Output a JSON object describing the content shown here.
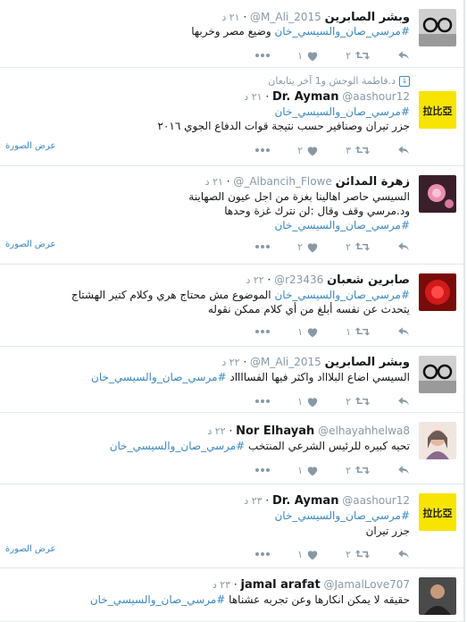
{
  "view_photo_label": "عرض الصورة",
  "tweets": [
    {
      "name": "وبشر الصابرين",
      "handle": "@M_Ali_2015",
      "time": "٢١ د",
      "lines": [
        [
          {
            "t": "#مرسي_صان_والسيسي_خان",
            "h": true
          },
          {
            "t": " وضيع مصر وخربها",
            "h": false
          }
        ]
      ],
      "retweets": "٢",
      "likes": "١",
      "has_photo": false
    },
    {
      "retweeted_by": "د.فاطمة الوحش و1 آخر يتابعان",
      "name": "Dr. Ayman",
      "handle": "@aashour12",
      "time": "٢١ د",
      "lines": [
        [
          {
            "t": "#مرسي_صان_والسيسي_خان",
            "h": true
          }
        ],
        [
          {
            "t": "جزر تيران وصنافير حسب نتيجة قوات الدفاع الجوي ٢٠١٦",
            "h": false
          }
        ]
      ],
      "retweets": "٣",
      "likes": "٢",
      "has_photo": true
    },
    {
      "name": "زهرة المدائن",
      "handle": "@_Albancih_Flowe",
      "time": "٢١ د",
      "lines": [
        [
          {
            "t": "السيسي حاصر اهالينا بغزة من اجل عيون الصهاينة",
            "h": false
          }
        ],
        [
          {
            "t": "ود.مرسي وقف وقال :لن نترك غزة وحدها",
            "h": false
          }
        ],
        [
          {
            "t": "#مرسي_صان_والسيسي_خان",
            "h": true
          }
        ]
      ],
      "retweets": "٢",
      "likes": "٢",
      "has_photo": true
    },
    {
      "name": "صابرين شعبان",
      "handle": "@r23436",
      "time": "٢٢ د",
      "lines": [
        [
          {
            "t": "#مرسي_صان_والسيسي_خان",
            "h": true
          },
          {
            "t": "  الموضوع  مش محتاج هري وكلام كتير  الهشتاج",
            "h": false
          }
        ],
        [
          {
            "t": "يتحدث عن نفسه  أبلغ من أي كلام ممكن نقوله",
            "h": false
          }
        ]
      ],
      "retweets": "١",
      "likes": "١",
      "has_photo": false
    },
    {
      "name": "وبشر الصابرين",
      "handle": "@M_Ali_2015",
      "time": "٢٢ د",
      "lines": [
        [
          {
            "t": "السيسي اضاع البلاااد واكثر فيها الفسااااد  ",
            "h": false
          },
          {
            "t": "#مرسي_صان_والسيسي_خان",
            "h": true
          }
        ]
      ],
      "retweets": "٢",
      "likes": "١",
      "has_photo": false
    },
    {
      "name": "Nor Elhayah",
      "handle": "@elhayahhelwa8",
      "time": "٢٢ د",
      "lines": [
        [
          {
            "t": "تحيه كبيره للرئيس الشرعي المنتخب  ",
            "h": false
          },
          {
            "t": "#مرسي_صان_والسيسي_خان",
            "h": true
          }
        ]
      ],
      "retweets": "٢",
      "likes": "١",
      "has_photo": false
    },
    {
      "name": "Dr. Ayman",
      "handle": "@aashour12",
      "time": "٢٣ د",
      "lines": [
        [
          {
            "t": "#مرسي_صان_والسيسي_خان",
            "h": true
          }
        ],
        [
          {
            "t": "جزر تيران",
            "h": false
          }
        ]
      ],
      "retweets": "٢",
      "likes": "١",
      "has_photo": true
    },
    {
      "name": "jamal arafat",
      "handle": "@JamalLove707",
      "time": "٢٣ د",
      "lines": [
        [
          {
            "t": "حقيقه لا يمكن انكارها وعن تجربه عشناها  ",
            "h": false
          },
          {
            "t": "#مرسي_صان_والسيسي_خان",
            "h": true
          }
        ]
      ],
      "retweets": "",
      "likes": "",
      "has_photo": false
    }
  ]
}
